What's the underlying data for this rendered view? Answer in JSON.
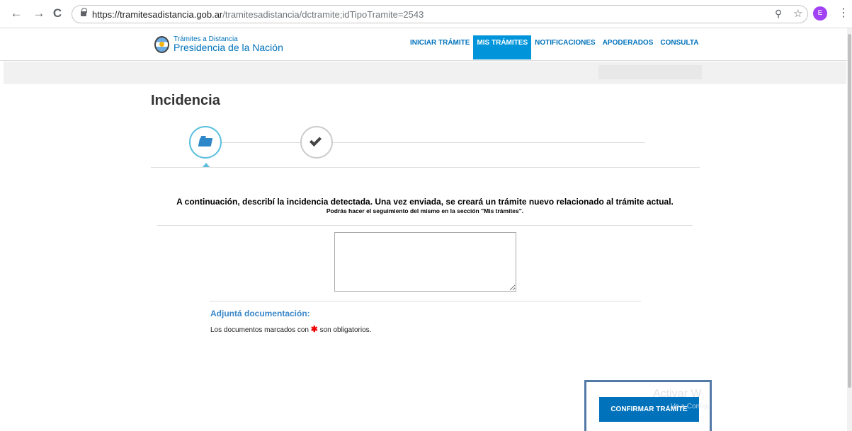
{
  "browser": {
    "back": "←",
    "forward": "→",
    "reload": "C",
    "url_host": "https://tramitesadistancia.gob.ar",
    "url_path": "/tramitesadistancia/dctramite;idTipoTramite=2543",
    "zoom_icon": "⚲",
    "star_icon": "☆",
    "profile_initial": "E",
    "menu_icon": "⋮"
  },
  "header": {
    "logo_line1": "Trámites a Distancia",
    "logo_line2": "Presidencia de la Nación",
    "nav": [
      "INICIAR TRÁMITE",
      "MIS TRÁMITES",
      "NOTIFICACIONES",
      "APODERADOS",
      "CONSULTA"
    ],
    "active_nav": "MIS TRÁMITES"
  },
  "main": {
    "title": "Incidencia",
    "intro": "A continuación, describí la incidencia detectada. Una vez enviada, se creará un trámite nuevo relacionado al trámite actual.",
    "intro_sub": "Podrás hacer el seguimiento del mismo en la sección \"Mis trámites\".",
    "textarea_value": "",
    "docs_title": "Adjuntá documentación:",
    "docs_note_before": "Los documentos marcados con",
    "docs_star": "✱",
    "docs_note_after": "son obligatorios.",
    "confirm_label": "CONFIRMAR TRÁMITE"
  },
  "watermark": {
    "line1": "Activar W",
    "line2": "Ve a Configu"
  },
  "colors": {
    "primary": "#0072bb",
    "active_nav": "#0095db",
    "step_active": "#5bc0de",
    "highlight_frame": "#5379a7"
  }
}
